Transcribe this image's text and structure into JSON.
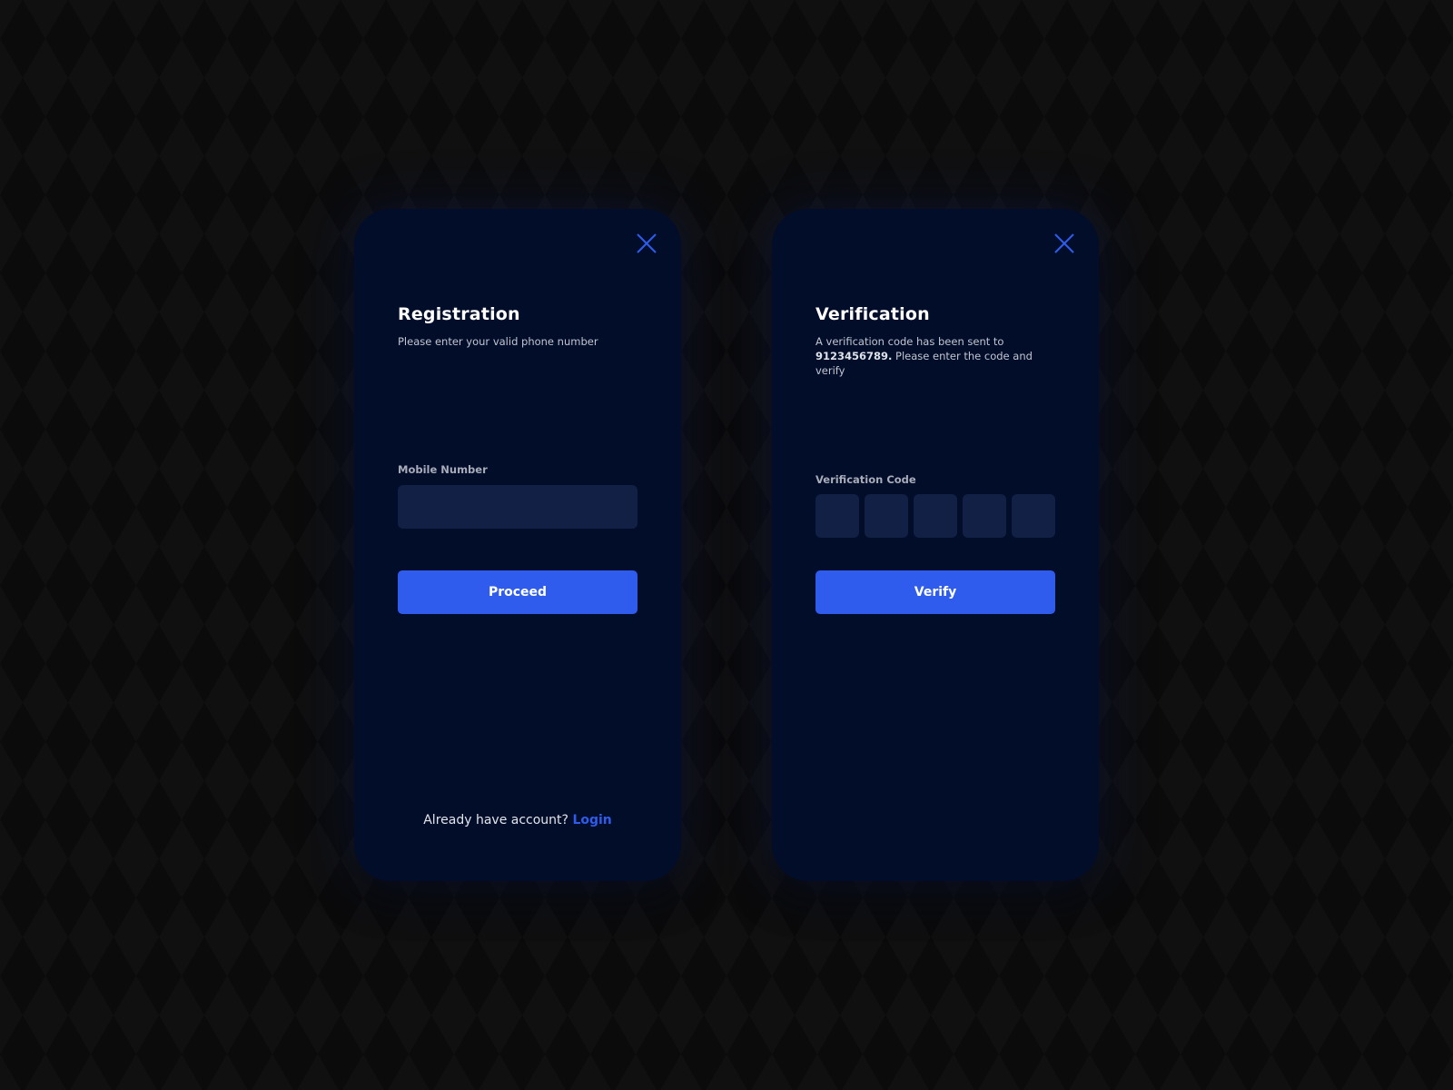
{
  "colors": {
    "background": "#0b0b0c",
    "card": "#020d2a",
    "input": "#132045",
    "accent": "#2f5cec",
    "text_primary": "#ffffff",
    "text_secondary": "#c2c6d2"
  },
  "registration": {
    "close_icon": "close-icon",
    "title": "Registration",
    "subtitle": "Please enter your valid phone number",
    "mobile_label": "Mobile Number",
    "mobile_value": "",
    "mobile_placeholder": "",
    "proceed_label": "Proceed",
    "footer_text": "Already have account?",
    "login_link": "Login"
  },
  "verification": {
    "close_icon": "close-icon",
    "title": "Verification",
    "subtitle_prefix": "A verification code has been sent to",
    "phone_number": "9123456789.",
    "subtitle_suffix": "Please enter the code and verify",
    "code_label": "Verification Code",
    "code_digits": [
      "",
      "",
      "",
      "",
      ""
    ],
    "verify_label": "Verify"
  }
}
